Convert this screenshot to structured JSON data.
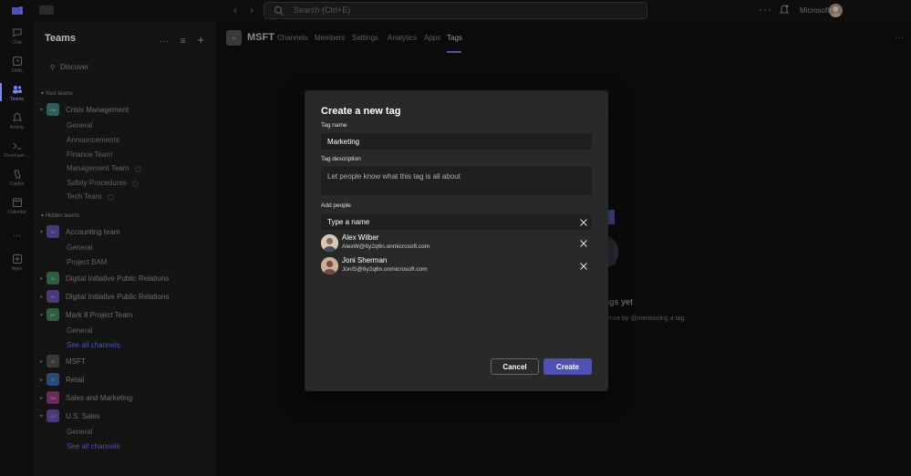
{
  "titlebar": {
    "search_placeholder": "Search (Ctrl+E)",
    "org_name": "Microsoft"
  },
  "rail": [
    {
      "label": "Chat",
      "icon": "chat-icon"
    },
    {
      "label": "Shifts",
      "icon": "shifts-icon"
    },
    {
      "label": "Teams",
      "icon": "teams-icon",
      "active": true
    },
    {
      "label": "Activity",
      "icon": "bell-icon"
    },
    {
      "label": "Developer ...",
      "icon": "developer-portal-icon"
    },
    {
      "label": "Copilot",
      "icon": "copilot-icon"
    },
    {
      "label": "Calendar",
      "icon": "calendar-icon"
    },
    {
      "label": "...",
      "icon": "more-icon"
    },
    {
      "label": "Apps",
      "icon": "apps-icon"
    }
  ],
  "panel": {
    "title": "Teams",
    "discover": "Discover",
    "your_teams_label": "Your teams",
    "hidden_teams_label": "Hidden teams",
    "crisis": {
      "abbr": "CM",
      "name": "Crisis Management",
      "color": "#2f5d5d",
      "channels": [
        "General",
        "Announcements",
        "Finance Team",
        "Management Team",
        "Safety Procedures",
        "Tech Team"
      ]
    },
    "accounting": {
      "abbr": "AT",
      "name": "Accounting team",
      "color": "#4a3a7a",
      "channels": [
        "General",
        "Project BAM"
      ]
    },
    "dipr1": {
      "abbr": "DI",
      "name": "Digital Initiative Public Relations",
      "color": "#2f5d3f"
    },
    "dipr2": {
      "abbr": "DI",
      "name": "Digital Initiative Public Relations",
      "color": "#4a3a7a"
    },
    "mark8": {
      "abbr": "MP",
      "name": "Mark 8 Project Team",
      "color": "#2f5d3f",
      "channels": [
        "General"
      ],
      "see_all": "See all channels"
    },
    "msft": {
      "abbr": "M",
      "name": "MSFT",
      "color": "#3a3a3a"
    },
    "retail": {
      "abbr": "R",
      "name": "Retail",
      "color": "#2a4a7a"
    },
    "sales": {
      "abbr": "SM",
      "name": "Sales and Marketing",
      "color": "#6a2a5a"
    },
    "ussales": {
      "abbr": "US",
      "name": "U.S. Sales",
      "color": "#4a3a7a",
      "channels": [
        "General"
      ],
      "see_all": "See all channels"
    }
  },
  "header": {
    "abbr": "M",
    "title": "MSFT",
    "tabs": [
      "Channels",
      "Members",
      "Settings",
      "Analytics",
      "Apps",
      "Tags"
    ],
    "active_tab": "Tags"
  },
  "background": {
    "empty_title": "ags yet",
    "empty_text": "ence by @mentioning a tag."
  },
  "modal": {
    "title": "Create a new tag",
    "tag_name_label": "Tag name",
    "tag_name_value": "Marketing",
    "tag_description_label": "Tag description",
    "tag_description_placeholder": "Let people know what this tag is all about",
    "add_people_label": "Add people",
    "add_people_placeholder": "Type a name",
    "people": [
      {
        "name": "Alex Wilber",
        "email": "AlexW@6y2q6n.onmicrosoft.com"
      },
      {
        "name": "Joni Sherman",
        "email": "JoniS@6y2q6n.onmicrosoft.com"
      }
    ],
    "cancel_label": "Cancel",
    "create_label": "Create"
  },
  "colors": {
    "accent": "#4f52b2",
    "rail_active": "#7f85f5",
    "modal_bg": "#292929",
    "input_bg": "#1f1f1f"
  }
}
